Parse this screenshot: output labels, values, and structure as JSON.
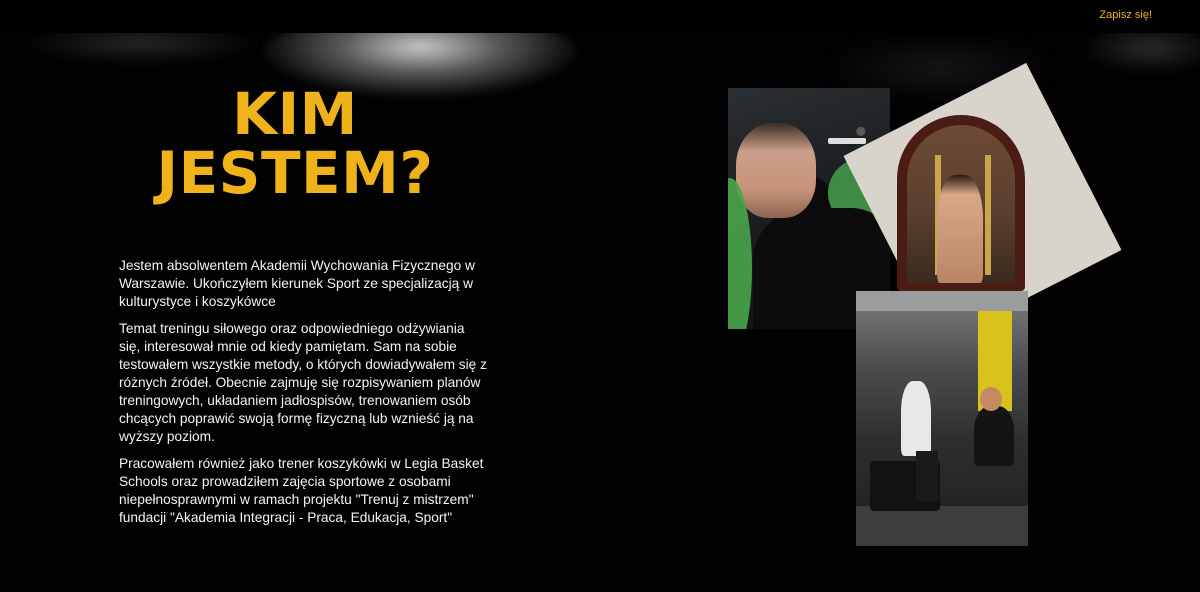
{
  "header": {
    "cta_label": "Zapisz się!"
  },
  "about": {
    "title_line1": "KIM",
    "title_line2": "JESTEM?",
    "paragraphs": [
      "Jestem absolwentem Akademii Wychowania Fizycznego w Warszawie. Ukończyłem kierunek Sport ze specjalizacją w kulturystyce i koszykówce",
      "Temat treningu siłowego oraz odpowiedniego odżywiania się, interesował mnie od kiedy pamiętam. Sam na sobie testowałem wszystkie metody, o których dowiadywałem się z różnych źródeł. Obecnie zajmuję się rozpisywaniem planów treningowych, układaniem jadłospisów, trenowaniem osób chcących poprawić swoją formę fizyczną lub wznieść ją na wyższy poziom.",
      "Pracowałem również jako trener koszykówki w Legia Basket Schools oraz prowadziłem zajęcia sportowe z osobami niepełnosprawnymi w ramach projektu \"Trenuj z mistrzem\" fundacji \"Akademia Integracji - Praca, Edukacja, Sport\""
    ]
  },
  "photos": [
    {
      "name": "athlete-photo"
    },
    {
      "name": "mirror-selfie-photo"
    },
    {
      "name": "trainers-photo"
    }
  ],
  "colors": {
    "accent": "#f0b21a",
    "background": "#000000",
    "text": "#f4f4f4"
  }
}
